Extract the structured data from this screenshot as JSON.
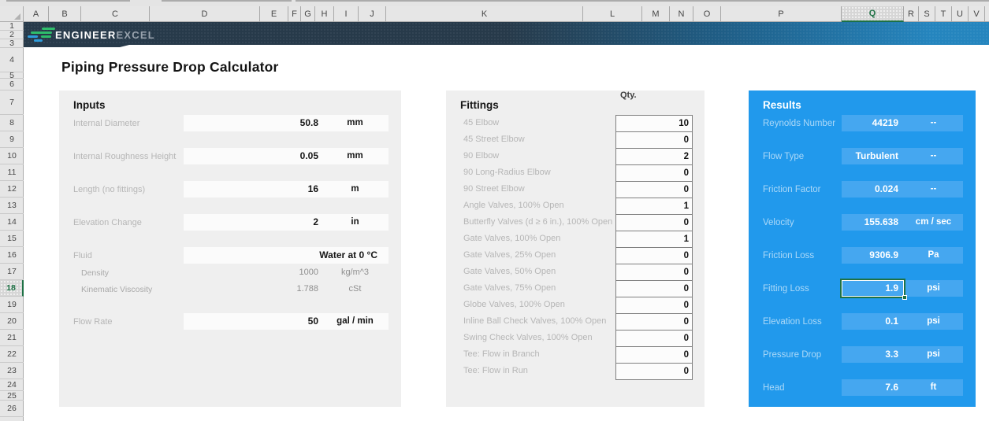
{
  "spreadsheet": {
    "column_headers": [
      "A",
      "B",
      "C",
      "D",
      "E",
      "F",
      "G",
      "H",
      "I",
      "J",
      "K",
      "L",
      "M",
      "N",
      "O",
      "P",
      "Q",
      "R",
      "S",
      "T",
      "U",
      "V"
    ],
    "row_headers": [
      "1",
      "2",
      "3",
      "4",
      "5",
      "6",
      "7",
      "8",
      "9",
      "10",
      "11",
      "12",
      "13",
      "14",
      "15",
      "16",
      "17",
      "18",
      "19",
      "20",
      "21",
      "22",
      "23",
      "24",
      "25",
      "26"
    ],
    "selected_column": "Q",
    "selected_row": "18"
  },
  "banner": {
    "brand_bold": "ENGINEER",
    "brand_light": "EXCEL"
  },
  "page": {
    "title": "Piping Pressure Drop Calculator"
  },
  "inputs": {
    "title": "Inputs",
    "fields": [
      {
        "label": "Internal Diameter",
        "value": "50.8",
        "unit": "mm"
      },
      {
        "label": "Internal Roughness Height",
        "value": "0.05",
        "unit": "mm"
      },
      {
        "label": "Length (no fittings)",
        "value": "16",
        "unit": "m"
      },
      {
        "label": "Elevation Change",
        "value": "2",
        "unit": "in"
      }
    ],
    "fluid": {
      "label": "Fluid",
      "value": "Water at 0 °C"
    },
    "fluid_props": [
      {
        "label": "Density",
        "value": "1000",
        "unit": "kg/m^3"
      },
      {
        "label": "Kinematic Viscosity",
        "value": "1.788",
        "unit": "cSt"
      }
    ],
    "flow_rate": {
      "label": "Flow Rate",
      "value": "50",
      "unit": "gal / min"
    }
  },
  "fittings": {
    "title": "Fittings",
    "qty_header": "Qty.",
    "rows": [
      {
        "label": "45 Elbow",
        "qty": "10"
      },
      {
        "label": "45 Street Elbow",
        "qty": "0"
      },
      {
        "label": "90 Elbow",
        "qty": "2"
      },
      {
        "label": "90 Long-Radius Elbow",
        "qty": "0"
      },
      {
        "label": "90 Street Elbow",
        "qty": "0"
      },
      {
        "label": "Angle Valves, 100% Open",
        "qty": "1"
      },
      {
        "label": "Butterfly Valves (d ≥ 6 in.), 100% Open",
        "qty": "0"
      },
      {
        "label": "Gate Valves, 100% Open",
        "qty": "1"
      },
      {
        "label": "Gate Valves, 25% Open",
        "qty": "0"
      },
      {
        "label": "Gate Valves, 50% Open",
        "qty": "0"
      },
      {
        "label": "Gate Valves, 75% Open",
        "qty": "0"
      },
      {
        "label": "Globe Valves, 100% Open",
        "qty": "0"
      },
      {
        "label": "Inline Ball Check Valves, 100% Open",
        "qty": "0"
      },
      {
        "label": "Swing Check Valves, 100% Open",
        "qty": "0"
      },
      {
        "label": "Tee: Flow in Branch",
        "qty": "0"
      },
      {
        "label": "Tee: Flow in Run",
        "qty": "0"
      }
    ]
  },
  "results": {
    "title": "Results",
    "rows": [
      {
        "label": "Reynolds Number",
        "value": "44219",
        "unit": "--",
        "selected": false
      },
      {
        "label": "Flow Type",
        "value": "Turbulent",
        "unit": "--",
        "selected": false
      },
      {
        "label": "Friction Factor",
        "value": "0.024",
        "unit": "--",
        "selected": false
      },
      {
        "label": "Velocity",
        "value": "155.638",
        "unit": "cm / sec",
        "selected": false
      },
      {
        "label": "Friction Loss",
        "value": "9306.9",
        "unit": "Pa",
        "selected": false
      },
      {
        "label": "Fitting Loss",
        "value": "1.9",
        "unit": "psi",
        "selected": true
      },
      {
        "label": "Elevation Loss",
        "value": "0.1",
        "unit": "psi",
        "selected": false
      },
      {
        "label": "Pressure Drop",
        "value": "3.3",
        "unit": "psi",
        "selected": false
      },
      {
        "label": "Head",
        "value": "7.6",
        "unit": "ft",
        "selected": false
      }
    ]
  },
  "colors": {
    "results_blue": "#2199ec",
    "results_box_blue": "#45a7f0",
    "selection_green": "#1e7145",
    "banner_navy": "#273a4a",
    "banner_blue": "#2585be",
    "logo_green": "#2ebd6b",
    "logo_blue": "#2d9cdb"
  }
}
